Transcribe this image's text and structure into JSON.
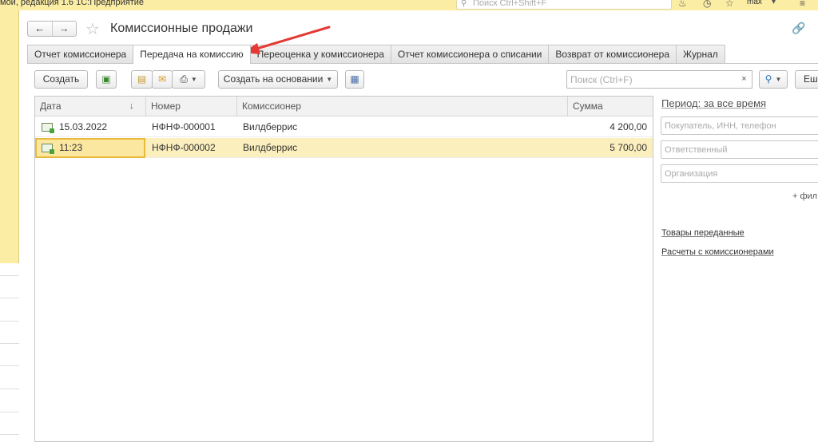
{
  "app": {
    "title": "мой, редакция 1.6 1С:Предприятие",
    "search_placeholder": "Поиск Ctrl+Shift+F",
    "user": "max"
  },
  "form": {
    "title": "Комиссионные продажи",
    "back_label": "←",
    "forward_label": "→"
  },
  "tabs": [
    {
      "label": "Отчет комиссионера"
    },
    {
      "label": "Передача на комиссию",
      "active": true
    },
    {
      "label": "Переоценка у комиссионера"
    },
    {
      "label": "Отчет комиссионера о списании"
    },
    {
      "label": "Возврат от комиссионера"
    },
    {
      "label": "Журнал"
    }
  ],
  "toolbar": {
    "create_label": "Создать",
    "create_based_label": "Создать на основании",
    "search_placeholder": "Поиск (Ctrl+F)",
    "clear_label": "×",
    "more_label": "Еш"
  },
  "table": {
    "columns": {
      "date": "Дата",
      "number": "Номер",
      "commissioner": "Комиссионер",
      "sum": "Сумма"
    },
    "rows": [
      {
        "date": "15.03.2022",
        "number": "НФНФ-000001",
        "commissioner": "Вилдберрис",
        "sum": "4 200,00"
      },
      {
        "date": "11:23",
        "number": "НФНФ-000002",
        "commissioner": "Вилдберрис",
        "sum": "5 700,00"
      }
    ]
  },
  "sidebar": {
    "period_label": "Период: за все время",
    "buyer_placeholder": "Покупатель, ИНН, телефон",
    "responsible_placeholder": "Ответственный",
    "organization_placeholder": "Организация",
    "add_filter_label": "+ фил",
    "links": [
      {
        "label": "Товары переданные"
      },
      {
        "label": "Расчеты с комиссионерами"
      }
    ]
  },
  "colors": {
    "accent_yellow": "#fbeda3",
    "selected_row": "#fcefbe",
    "arrow_red": "#e53935"
  }
}
